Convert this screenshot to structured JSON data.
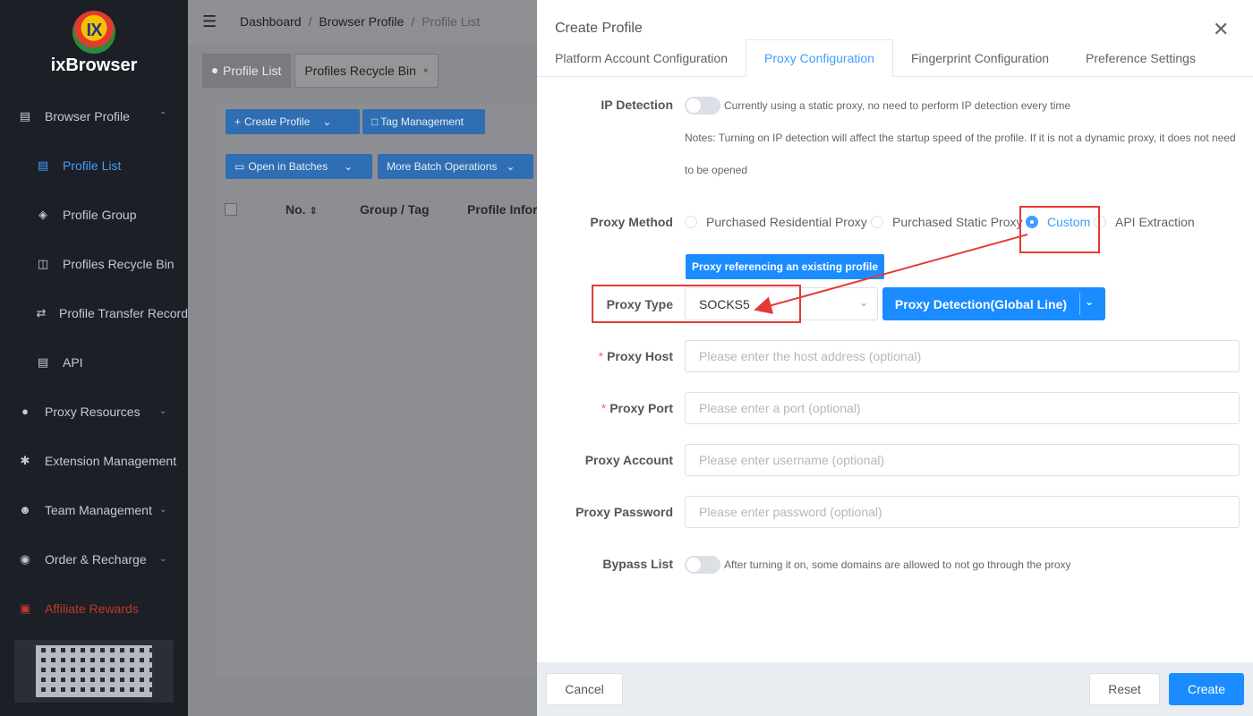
{
  "sidebar": {
    "logo_mark": "IX",
    "logo_text": "ixBrowser",
    "items": [
      {
        "label": "Browser Profile",
        "icon": "calendar-icon"
      },
      {
        "label": "Profile List",
        "icon": "calendar-icon"
      },
      {
        "label": "Profile Group",
        "icon": "layers-icon"
      },
      {
        "label": "Profiles Recycle Bin",
        "icon": "trash-icon"
      },
      {
        "label": "Profile Transfer Record",
        "icon": "transfer-icon"
      },
      {
        "label": "API",
        "icon": "calendar-icon"
      },
      {
        "label": "Proxy Resources",
        "icon": "globe-icon"
      },
      {
        "label": "Extension Management",
        "icon": "puzzle-icon"
      },
      {
        "label": "Team Management",
        "icon": "user-icon"
      },
      {
        "label": "Order & Recharge",
        "icon": "coin-icon"
      },
      {
        "label": "Affiliate Rewards",
        "icon": "gift-icon"
      }
    ]
  },
  "breadcrumb": [
    "Dashboard",
    "Browser Profile",
    "Profile List"
  ],
  "page_tabs": [
    {
      "label": "Profile List"
    },
    {
      "label": "Profiles Recycle Bin"
    }
  ],
  "toolbar": {
    "create_profile": "Create Profile",
    "tag_management": "Tag Management",
    "open_in_batches": "Open in Batches",
    "more_batch_operations": "More Batch Operations"
  },
  "table": {
    "columns": [
      "No.",
      "Group / Tag",
      "Profile Infor"
    ]
  },
  "drawer": {
    "title": "Create Profile",
    "tabs": [
      "Platform Account Configuration",
      "Proxy Configuration",
      "Fingerprint Configuration",
      "Preference Settings"
    ],
    "active_tab": "Proxy Configuration",
    "ip_detection": {
      "label": "IP Detection",
      "hint": "Currently using a static proxy, no need to perform IP detection every time",
      "notes_line1": "Notes: Turning on IP detection will affect the startup speed of the profile. If it is not a dynamic proxy, it does not need",
      "notes_line2": "to be opened"
    },
    "proxy_method": {
      "label": "Proxy Method",
      "options": [
        "Purchased Residential Proxy",
        "Purchased Static Proxy",
        "Custom",
        "API Extraction"
      ],
      "selected": "Custom",
      "reference_button": "Proxy referencing an existing profile"
    },
    "proxy_type": {
      "label": "Proxy Type",
      "value": "SOCKS5",
      "detect_button": "Proxy Detection(Global Line)"
    },
    "proxy_host": {
      "label": "Proxy Host",
      "placeholder": "Please enter the host address (optional)"
    },
    "proxy_port": {
      "label": "Proxy Port",
      "placeholder": "Please enter a port (optional)"
    },
    "proxy_account": {
      "label": "Proxy Account",
      "placeholder": "Please enter username (optional)"
    },
    "proxy_password": {
      "label": "Proxy Password",
      "placeholder": "Please enter password (optional)"
    },
    "bypass_list": {
      "label": "Bypass List",
      "hint": "After turning it on, some domains are allowed to not go through the proxy"
    },
    "footer": {
      "cancel": "Cancel",
      "reset": "Reset",
      "create": "Create"
    }
  },
  "colors": {
    "accent": "#1a8cff",
    "highlight": "#e53935",
    "required": "#f56c6c"
  }
}
